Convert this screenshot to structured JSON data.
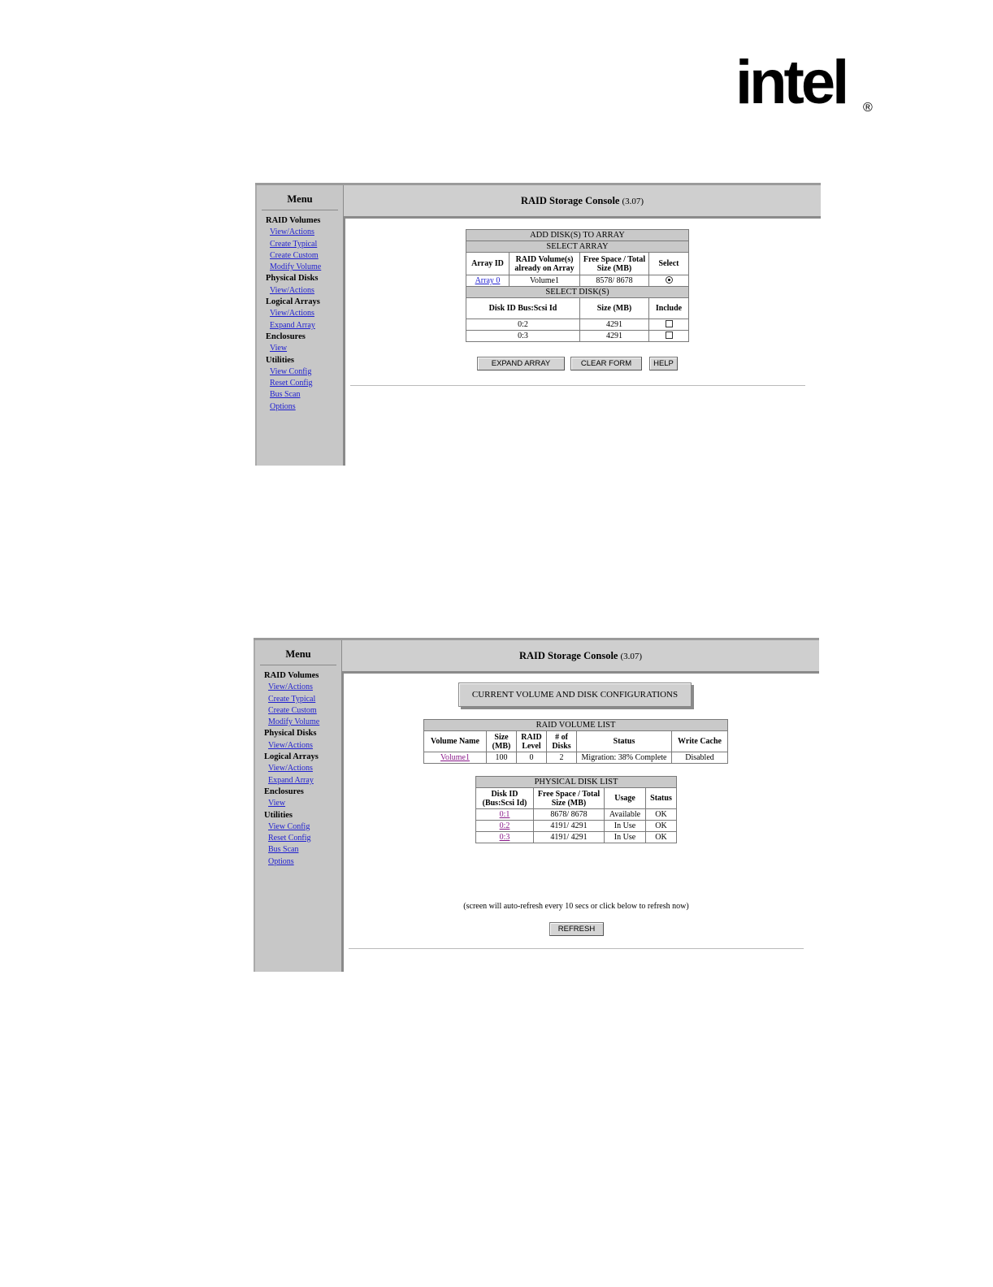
{
  "logo": {
    "text": "intel",
    "reg": "®"
  },
  "shot1": {
    "menu": {
      "title": "Menu",
      "sections": [
        {
          "label": "RAID Volumes",
          "links": [
            "View/Actions",
            "Create Typical",
            "Create Custom",
            "Modify Volume"
          ]
        },
        {
          "label": "Physical Disks",
          "links": [
            "View/Actions"
          ]
        },
        {
          "label": "Logical Arrays",
          "links": [
            "View/Actions",
            "Expand Array"
          ]
        },
        {
          "label": "Enclosures",
          "links": [
            "View"
          ]
        },
        {
          "label": "Utilities",
          "links": [
            "View Config",
            "Reset Config",
            "Bus Scan",
            "Options"
          ]
        }
      ]
    },
    "header": {
      "title": "RAID Storage Console",
      "version": "(3.07)"
    },
    "form": {
      "title": "ADD DISK(S) TO ARRAY",
      "select_array": "SELECT ARRAY",
      "array_cols": [
        "Array ID",
        "RAID Volume(s) already on Array",
        "Free Space / Total Size (MB)",
        "Select"
      ],
      "array_row": {
        "id": "Array 0",
        "volumes": "Volume1",
        "space": "8578/ 8678"
      },
      "select_disks": "SELECT DISK(S)",
      "disk_cols": [
        "Disk ID Bus:Scsi Id",
        "Size (MB)",
        "Include"
      ],
      "disk_rows": [
        {
          "id": "0:2",
          "size": "4291"
        },
        {
          "id": "0:3",
          "size": "4291"
        }
      ],
      "buttons": {
        "expand": "EXPAND ARRAY",
        "clear": "CLEAR FORM",
        "help": "HELP"
      }
    }
  },
  "shot2": {
    "menu": {
      "title": "Menu",
      "sections": [
        {
          "label": "RAID Volumes",
          "links": [
            "View/Actions",
            "Create Typical",
            "Create Custom",
            "Modify Volume"
          ]
        },
        {
          "label": "Physical Disks",
          "links": [
            "View/Actions"
          ]
        },
        {
          "label": "Logical Arrays",
          "links": [
            "View/Actions",
            "Expand Array"
          ]
        },
        {
          "label": "Enclosures",
          "links": [
            "View"
          ]
        },
        {
          "label": "Utilities",
          "links": [
            "View Config",
            "Reset Config",
            "Bus Scan",
            "Options"
          ]
        }
      ]
    },
    "header": {
      "title": "RAID Storage Console",
      "version": "(3.07)"
    },
    "banner": "CURRENT VOLUME AND DISK CONFIGURATIONS",
    "volume_list": {
      "title": "RAID VOLUME LIST",
      "cols": [
        "Volume Name",
        "Size (MB)",
        "RAID Level",
        "# of Disks",
        "Status",
        "Write Cache"
      ],
      "rows": [
        {
          "name": "Volume1",
          "size": "100",
          "level": "0",
          "disks": "2",
          "status": "Migration: 38% Complete",
          "cache": "Disabled"
        }
      ]
    },
    "disk_list": {
      "title": "PHYSICAL DISK LIST",
      "cols": [
        "Disk ID (Bus:Scsi Id)",
        "Free Space / Total Size (MB)",
        "Usage",
        "Status"
      ],
      "rows": [
        {
          "id": "0:1",
          "space": "8678/ 8678",
          "usage": "Available",
          "status": "OK"
        },
        {
          "id": "0:2",
          "space": "4191/ 4291",
          "usage": "In Use",
          "status": "OK"
        },
        {
          "id": "0:3",
          "space": "4191/ 4291",
          "usage": "In Use",
          "status": "OK"
        }
      ]
    },
    "refresh_note": "(screen will auto-refresh every 10 secs or click below to refresh now)",
    "refresh_button": "REFRESH"
  }
}
